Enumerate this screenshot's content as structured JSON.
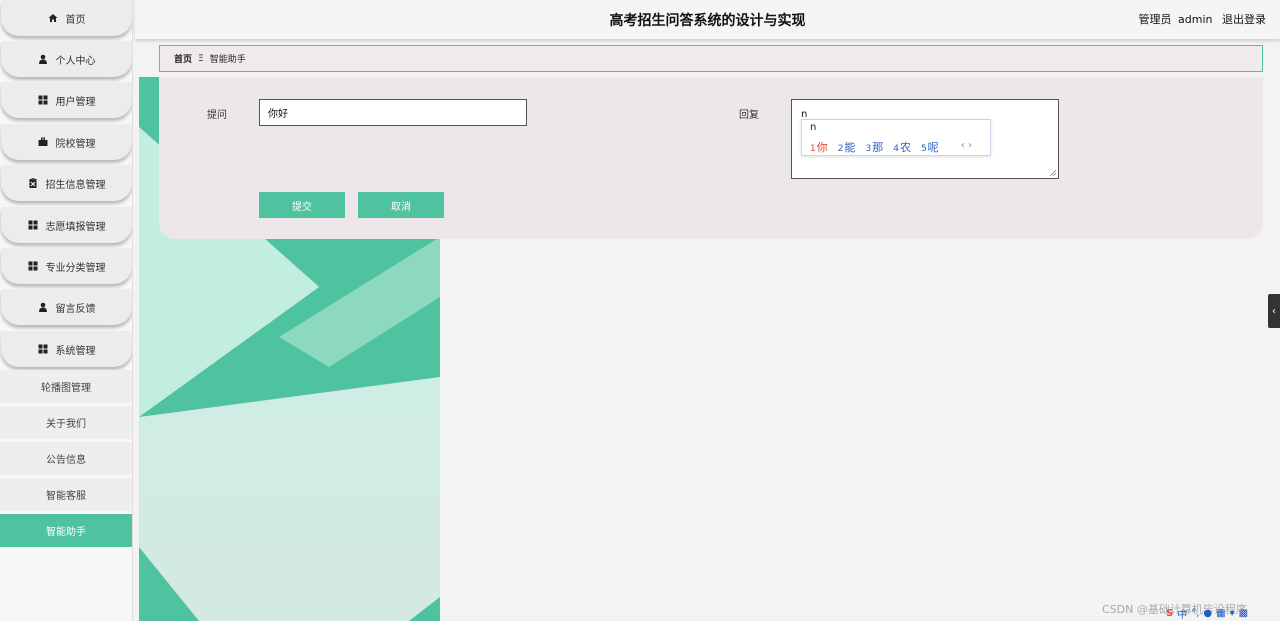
{
  "header": {
    "title": "高考招生问答系统的设计与实现",
    "role": "管理员",
    "username": "admin",
    "logout_label": "退出登录"
  },
  "sidebar": {
    "menus": [
      {
        "label": "首页",
        "icon": "home-icon"
      },
      {
        "label": "个人中心",
        "icon": "user-icon"
      },
      {
        "label": "用户管理",
        "icon": "grid-icon"
      },
      {
        "label": "院校管理",
        "icon": "briefcase-icon"
      },
      {
        "label": "招生信息管理",
        "icon": "clipboard-icon"
      },
      {
        "label": "志愿填报管理",
        "icon": "grid-icon"
      },
      {
        "label": "专业分类管理",
        "icon": "grid-icon"
      },
      {
        "label": "留言反馈",
        "icon": "user-icon"
      },
      {
        "label": "系统管理",
        "icon": "grid-icon"
      }
    ],
    "sub_items": [
      {
        "label": "轮播图管理"
      },
      {
        "label": "关于我们"
      },
      {
        "label": "公告信息"
      },
      {
        "label": "智能客服"
      },
      {
        "label": "智能助手",
        "active": true
      }
    ]
  },
  "breadcrumb": {
    "home": "首页",
    "separator": "Ξ",
    "current": "智能助手"
  },
  "form": {
    "question_label": "提问",
    "question_value": "你好",
    "reply_label": "回复",
    "reply_value": "n",
    "submit_label": "提交",
    "cancel_label": "取消"
  },
  "ime": {
    "composition": "n",
    "candidates": [
      {
        "num": "1",
        "text": "你"
      },
      {
        "num": "2",
        "text": "能"
      },
      {
        "num": "3",
        "text": "那"
      },
      {
        "num": "4",
        "text": "农"
      },
      {
        "num": "5",
        "text": "呢"
      }
    ],
    "nav": "‹ ›"
  },
  "collapse_tab": "‹",
  "watermark": "CSDN @基础计算机毕设程序",
  "tray": {
    "lang": "中"
  },
  "colors": {
    "accent": "#4fc29f",
    "panel": "#ece8ea",
    "deco_light": "#c4eee0",
    "deco_dark": "#4fc29f"
  }
}
